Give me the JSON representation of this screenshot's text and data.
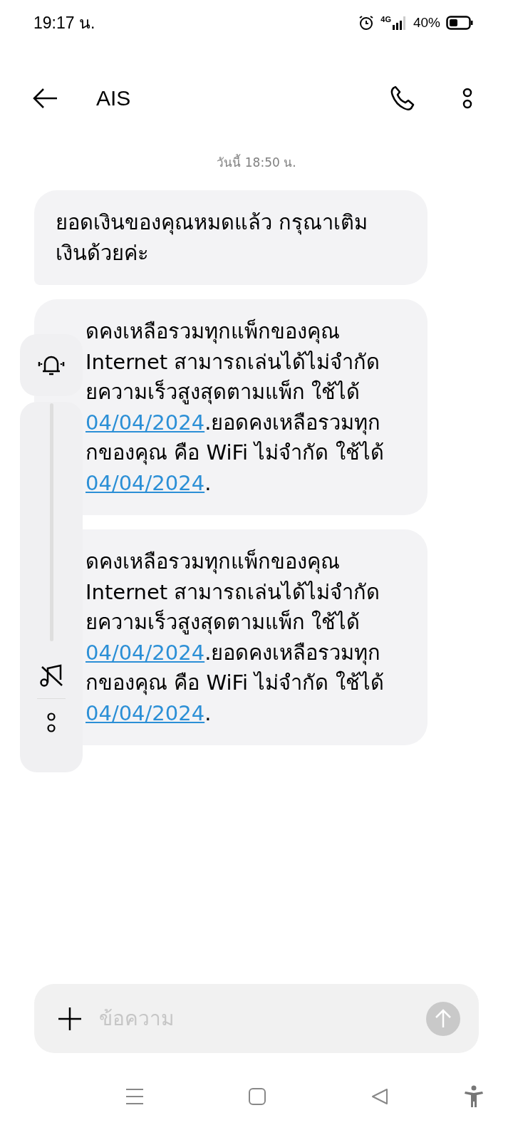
{
  "status_bar": {
    "time": "19:17 น.",
    "network": "4G",
    "battery": "40%"
  },
  "header": {
    "title": "AIS"
  },
  "date_label": "วันนี้ 18:50 น.",
  "messages": [
    {
      "kind": "full",
      "lines": [
        "ยอดเงินของคุณหมดแล้ว กรุณาเติม",
        "เงินด้วยค่ะ"
      ]
    },
    {
      "kind": "covered",
      "lines": [
        [
          {
            "text": "ดคงเหลือรวมทุกแพ็กของคุณ",
            "link": false
          }
        ],
        [
          {
            "text": " Internet สามารถเล่นได้ไม่จำกัด",
            "link": false
          }
        ],
        [
          {
            "text": "ยความเร็วสูงสุดตามแพ็ก ใช้ได้",
            "link": false
          }
        ],
        [
          {
            "text": "04/04/2024",
            "link": true
          },
          {
            "text": ".ยอดคงเหลือรวมทุก",
            "link": false
          }
        ],
        [
          {
            "text": "กของคุณ คือ WiFi ไม่จำกัด ใช้ได้",
            "link": false
          }
        ],
        [
          {
            "text": "04/04/2024",
            "link": true
          },
          {
            "text": ".",
            "link": false
          }
        ]
      ]
    },
    {
      "kind": "covered",
      "lines": [
        [
          {
            "text": "ดคงเหลือรวมทุกแพ็กของคุณ",
            "link": false
          }
        ],
        [
          {
            "text": " Internet สามารถเล่นได้ไม่จำกัด",
            "link": false
          }
        ],
        [
          {
            "text": "ยความเร็วสูงสุดตามแพ็ก ใช้ได้",
            "link": false
          }
        ],
        [
          {
            "text": "04/04/2024",
            "link": true
          },
          {
            "text": ".ยอดคงเหลือรวมทุก",
            "link": false
          }
        ],
        [
          {
            "text": "กของคุณ คือ WiFi ไม่จำกัด ใช้ได้",
            "link": false
          }
        ],
        [
          {
            "text": "04/04/2024",
            "link": true
          },
          {
            "text": ".",
            "link": false
          }
        ]
      ]
    }
  ],
  "volume_panel": {
    "level": 0
  },
  "composer": {
    "placeholder": "ข้อความ"
  }
}
